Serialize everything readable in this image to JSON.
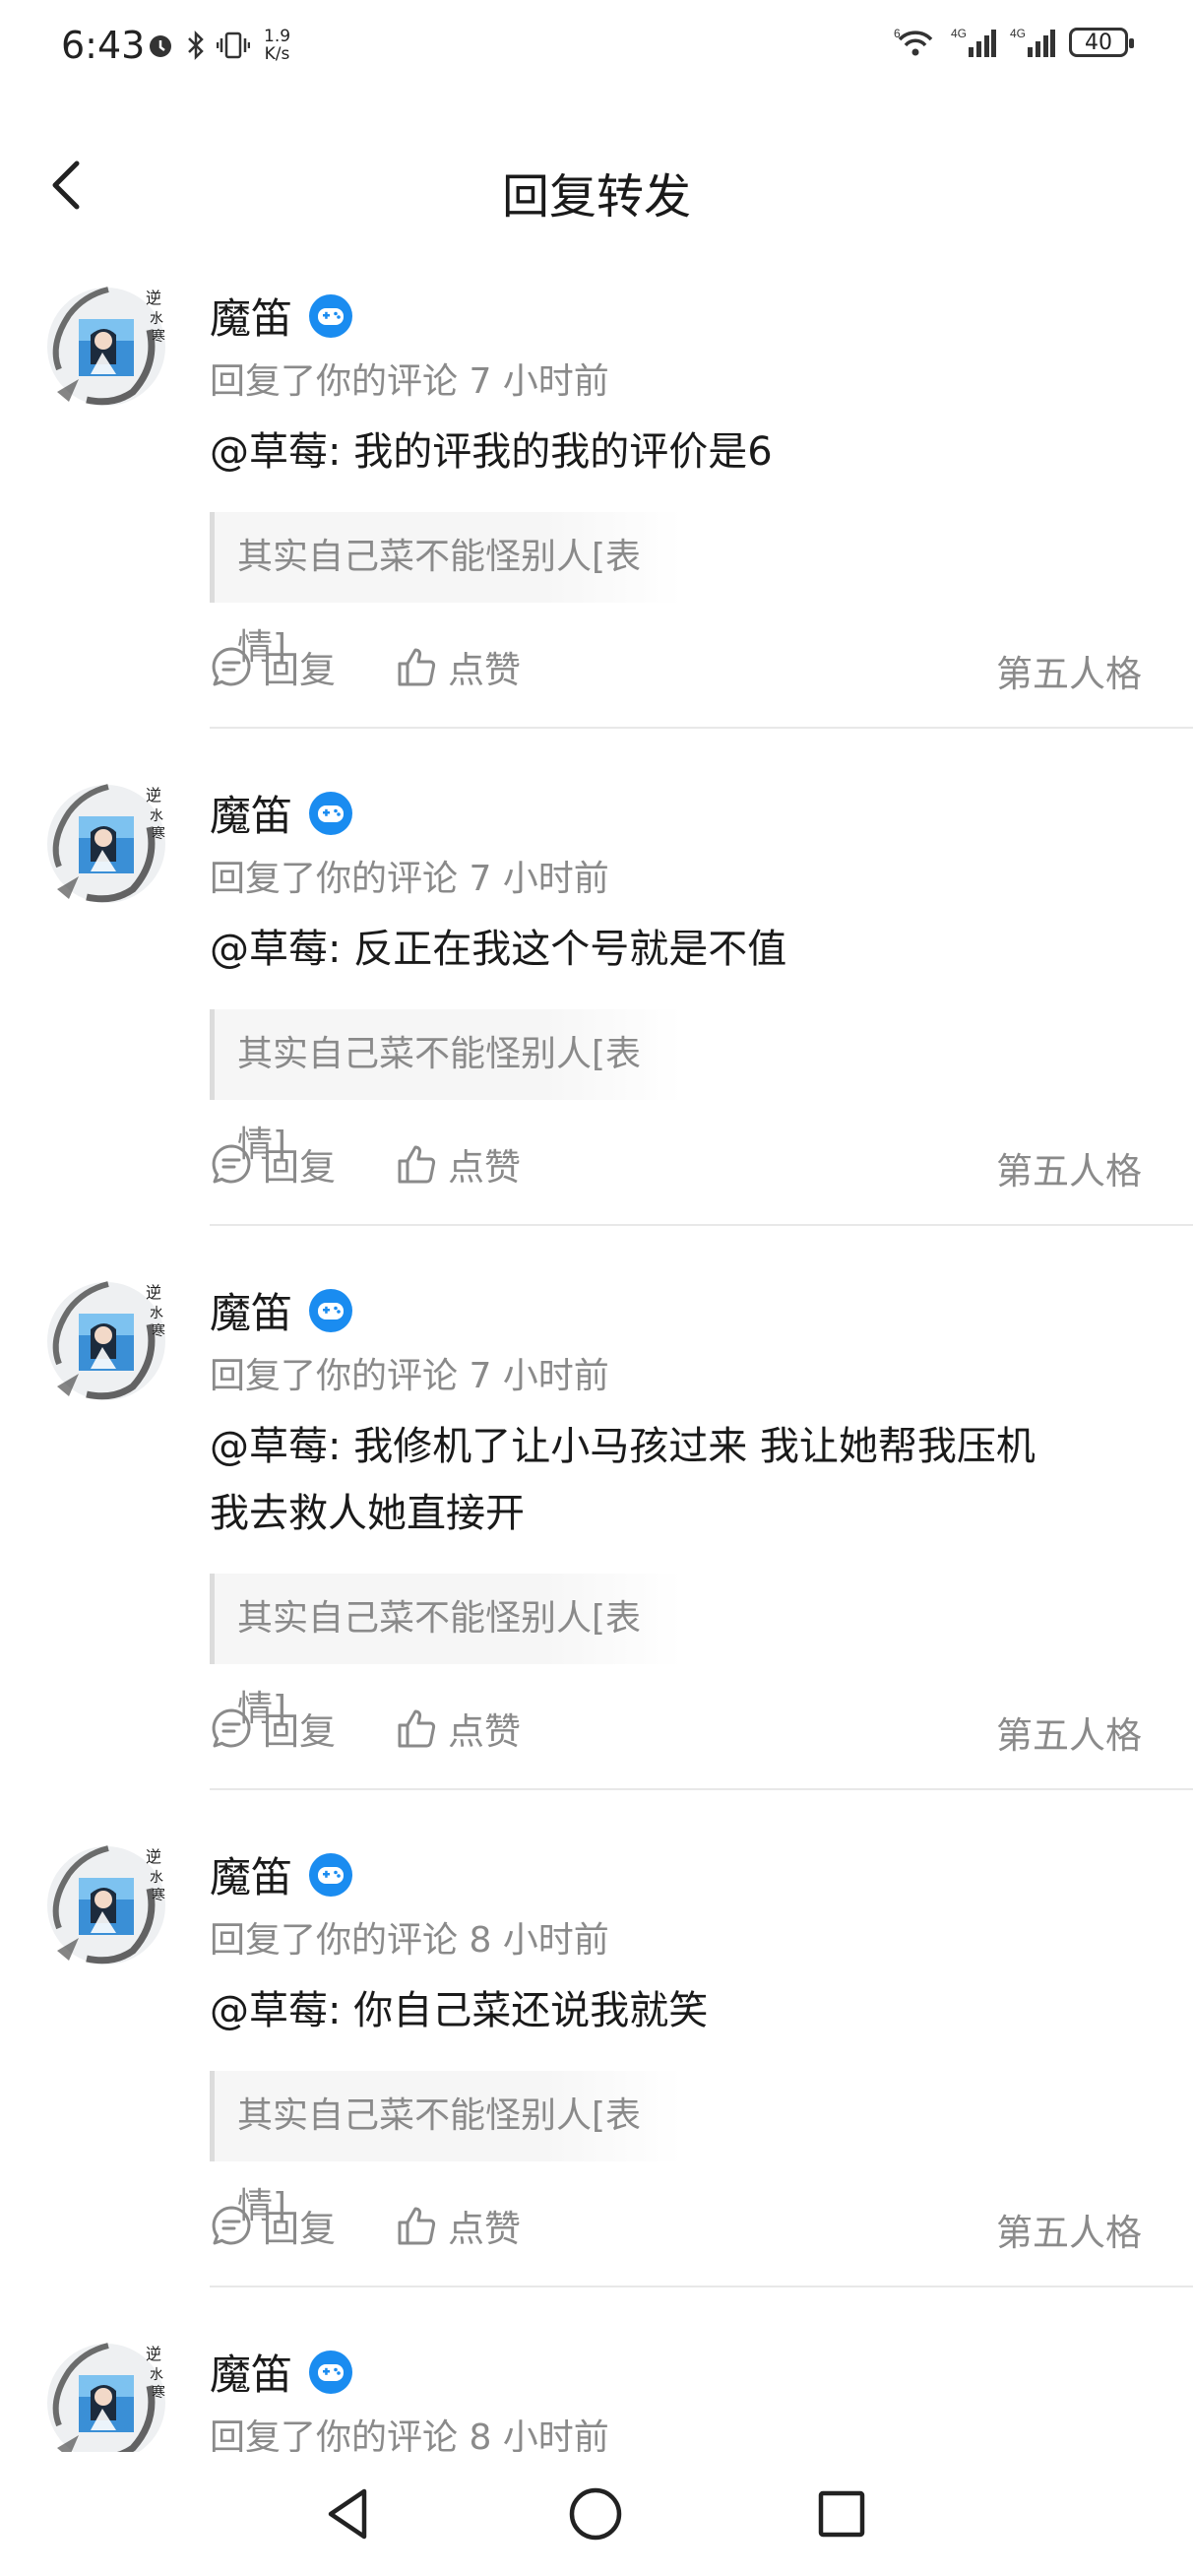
{
  "status_bar": {
    "time": "6:43",
    "speed_top": "1.9",
    "speed_bottom": "K/s",
    "battery": "40",
    "net1": "4G",
    "net2": "4G",
    "wifi_tag": "6"
  },
  "header": {
    "title": "回复转发"
  },
  "comments": [
    {
      "name": "魔笛",
      "meta": "回复了你的评论 7 小时前",
      "content_lines": [
        "@草莓: 我的评我的我的评价是6"
      ],
      "quote": "其实自己菜不能怪别人[表情]",
      "reply_label": "回复",
      "like_label": "点赞",
      "tag": "第五人格"
    },
    {
      "name": "魔笛",
      "meta": "回复了你的评论 7 小时前",
      "content_lines": [
        "@草莓: 反正在我这个号就是不值"
      ],
      "quote": "其实自己菜不能怪别人[表情]",
      "reply_label": "回复",
      "like_label": "点赞",
      "tag": "第五人格"
    },
    {
      "name": "魔笛",
      "meta": "回复了你的评论 7 小时前",
      "content_lines": [
        "@草莓: 我修机了让小马孩过来 我让她帮我压机",
        "我去救人她直接开"
      ],
      "quote": "其实自己菜不能怪别人[表情]",
      "reply_label": "回复",
      "like_label": "点赞",
      "tag": "第五人格"
    },
    {
      "name": "魔笛",
      "meta": "回复了你的评论 8 小时前",
      "content_lines": [
        "@草莓: 你自己菜还说我就笑"
      ],
      "quote": "其实自己菜不能怪别人[表情]",
      "reply_label": "回复",
      "like_label": "点赞",
      "tag": "第五人格"
    },
    {
      "name": "魔笛",
      "meta": "回复了你的评论 8 小时前"
    }
  ],
  "icons": {
    "back": "chevron-left-icon",
    "badge": "game-controller-icon",
    "reply": "comment-bubble-icon",
    "like": "thumbs-up-icon"
  },
  "colors": {
    "badge_blue": "#1a8cf0",
    "secondary_text": "#8a8a8a",
    "divider": "#e8e8e8"
  }
}
